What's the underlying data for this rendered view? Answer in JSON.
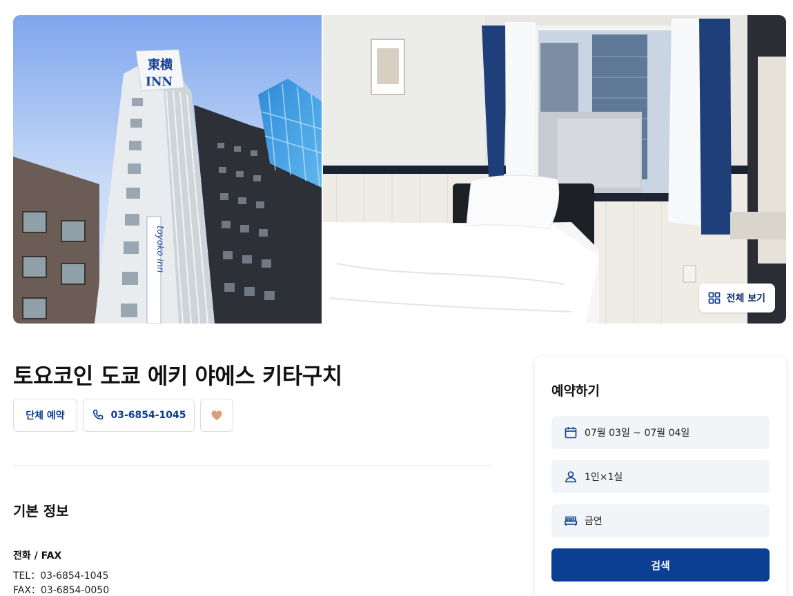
{
  "gallery": {
    "view_all_label": "전체 보기",
    "exterior_sign": "東横 INN",
    "exterior_vertical_sign": "toyoko inn"
  },
  "hotel": {
    "name": "토요코인 도쿄 에키 야에스 키타구치",
    "group_booking_label": "단체 예약",
    "phone_label": "03-6854-1045"
  },
  "basic_info": {
    "title": "기본 정보",
    "contact_label": "전화 / FAX",
    "tel": "TEL：03-6854-1045",
    "fax": "FAX：03-6854-0050"
  },
  "booking": {
    "title": "예약하기",
    "dates": "07월 03일 ~ 07월 04일",
    "guests": "1인×1실",
    "smoking": "금연",
    "search_label": "검색"
  },
  "icons": {
    "view_all": "grid-icon",
    "phone": "phone-icon",
    "favorite": "heart-icon",
    "dates": "calendar-icon",
    "guests": "person-icon",
    "smoking": "bed-icon"
  },
  "colors": {
    "brand_navy": "#0b3f94",
    "text_navy": "#0b3b8c",
    "heart": "#d9a07a",
    "field_bg": "#f2f5f8"
  }
}
